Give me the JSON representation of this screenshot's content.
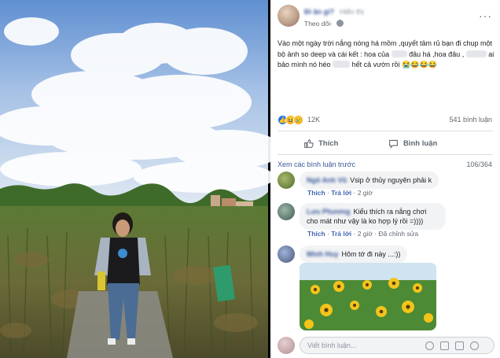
{
  "post": {
    "author": "Đi ăn gì?",
    "author_extra": "Hiển thị",
    "follow_label": "Theo dõi",
    "dot": "·",
    "more_label": "···",
    "text_part1": "Vào một ngày trời nắng nóng há mồm ,quyết tâm rủ bạn đi chụp một bộ ảnh so deep và cái kết : hoa của",
    "text_part2": "đâu há ,hoa đâu ,",
    "text_part3": "ai bảo mình nó héo",
    "text_part4": "hết cả vườn rồi",
    "emojis": "😭😂😂😂",
    "reaction_count": "12K",
    "comment_count": "541 bình luận"
  },
  "actions": {
    "like_label": "Thích",
    "comment_label": "Bình luận"
  },
  "comments_header": {
    "view_previous": "Xem các bình luận trước",
    "count": "106/364"
  },
  "comments": [
    {
      "name": "Ngô Anh Vũ",
      "text": "Vsip ở thủy nguyên phải k",
      "like": "Thích",
      "reply": "Trả lời",
      "time": "2 giờ",
      "edited": ""
    },
    {
      "name": "Lưu Phương",
      "text": "Kiểu thích ra nắng chơi cho mát như vậy là ko hợp lý rồi =))))",
      "like": "Thích",
      "reply": "Trả lời",
      "time": "2 giờ",
      "edited": "Đã chỉnh sửa"
    },
    {
      "name": "Minh Huy",
      "text": "Hôm tớ đi này ...:))",
      "like": "",
      "reply": "",
      "time": "",
      "edited": ""
    }
  ],
  "composer": {
    "placeholder": "Viết bình luận..."
  },
  "colors": {
    "link": "#385898",
    "like_blue": "#1877f2",
    "sky": "#8fb6e3",
    "grass": "#5e7a36"
  },
  "icons": [
    "more-icon",
    "globe-icon",
    "like-reaction-icon",
    "haha-reaction-icon",
    "sad-reaction-icon",
    "thumbs-up-icon",
    "comment-icon",
    "emoji-icon",
    "camera-icon",
    "gif-icon",
    "sticker-icon"
  ]
}
